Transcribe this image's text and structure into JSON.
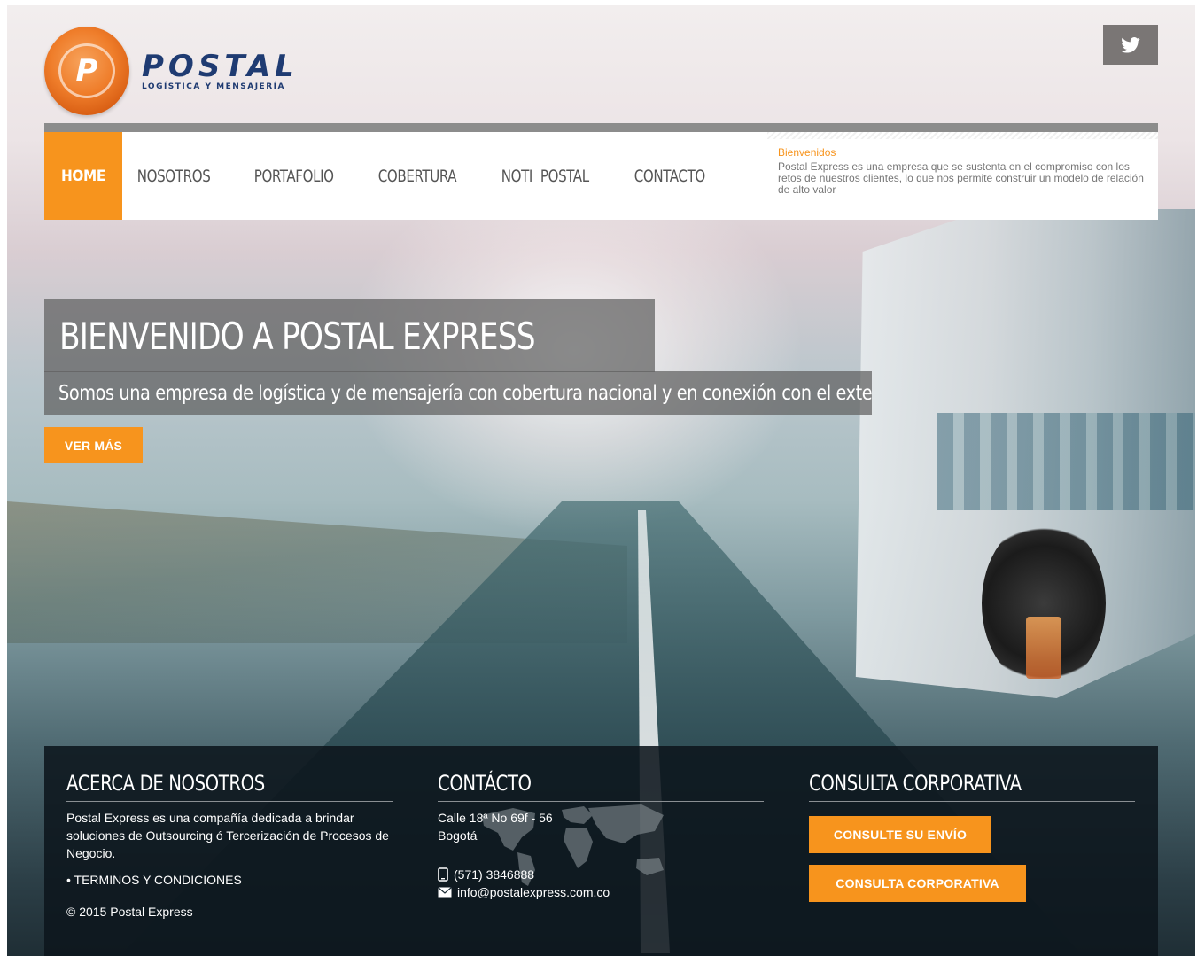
{
  "brand": {
    "logo_letter": "P",
    "name": "POSTAL",
    "tagline": "LOGÍSTICA Y MENSAJERÍA",
    "accent_color": "#f7941d",
    "navy_color": "#1f3b72"
  },
  "social": {
    "twitter_icon": "twitter-icon"
  },
  "nav": {
    "items": [
      {
        "label": "HOME",
        "active": true
      },
      {
        "label": "NOSOTROS",
        "active": false
      },
      {
        "label": "PORTAFOLIO",
        "active": false
      },
      {
        "label": "COBERTURA",
        "active": false
      },
      {
        "label": "NOTI  POSTAL",
        "active": false
      },
      {
        "label": "CONTACTO",
        "active": false
      }
    ],
    "welcome": {
      "title": "Bienvenidos",
      "text": "Postal Express es una empresa que se sustenta en el compromiso con los retos de nuestros clientes, lo que nos permite construir un modelo de relación de alto valor"
    }
  },
  "hero": {
    "title": "BIENVENIDO A POSTAL EXPRESS",
    "subtitle": "Somos una empresa de logística y de mensajería con cobertura nacional y en conexión con el exterior.",
    "button_label": "VER MÁS"
  },
  "footer": {
    "about": {
      "heading": "ACERCA DE NOSOTROS",
      "text": "Postal Express es una compañía dedicada a brindar soluciones de Outsourcing ó Tercerización de Procesos de Negocio.",
      "link_bullet": "•",
      "link_label": "TERMINOS Y CONDICIONES",
      "copyright": "© 2015 Postal Express"
    },
    "contact": {
      "heading": "CONTÁCTO",
      "address_line1": "Calle 18ª No 69f - 56",
      "address_line2": "Bogotá",
      "phone": "(571) 3846888",
      "email": "info@postalexpress.com.co"
    },
    "corporate": {
      "heading": "CONSULTA CORPORATIVA",
      "button1": "CONSULTE SU ENVÍO",
      "button2": "CONSULTA CORPORATIVA"
    }
  }
}
